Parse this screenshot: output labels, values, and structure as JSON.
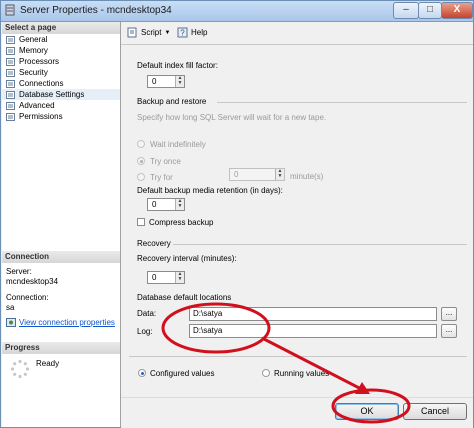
{
  "window": {
    "title": "Server Properties - mcndesktop34",
    "minimize": "–",
    "maximize": "□",
    "close": "X"
  },
  "left": {
    "select_page_header": "Select a page",
    "pages": [
      {
        "label": "General",
        "icon": "page-icon"
      },
      {
        "label": "Memory",
        "icon": "page-icon"
      },
      {
        "label": "Processors",
        "icon": "page-icon"
      },
      {
        "label": "Security",
        "icon": "page-icon"
      },
      {
        "label": "Connections",
        "icon": "page-icon"
      },
      {
        "label": "Database Settings",
        "icon": "page-icon"
      },
      {
        "label": "Advanced",
        "icon": "page-icon"
      },
      {
        "label": "Permissions",
        "icon": "page-icon"
      }
    ],
    "connection_header": "Connection",
    "server_label": "Server:",
    "server_value": "mcndesktop34",
    "connection_label": "Connection:",
    "connection_value": "sa",
    "view_connection_link": "View connection properties",
    "progress_header": "Progress",
    "progress_status": "Ready"
  },
  "toolbar": {
    "script_label": "Script",
    "help_label": "Help"
  },
  "form": {
    "fill_factor_label": "Default index fill factor:",
    "fill_factor_value": "0",
    "backup_section": "Backup and restore",
    "backup_hint": "Specify how long SQL Server will wait for a new tape.",
    "wait_indefinitely": "Wait indefinitely",
    "try_once": "Try once",
    "try_for": "Try for",
    "try_for_value": "0",
    "minutes_unit": "minute(s)",
    "retention_label": "Default backup media retention (in days):",
    "retention_value": "0",
    "compress_backup": "Compress backup",
    "recovery_section": "Recovery",
    "recovery_interval_label": "Recovery interval (minutes):",
    "recovery_interval_value": "0",
    "db_locations_label": "Database default locations",
    "data_label": "Data:",
    "data_value": "D:\\satya",
    "log_label": "Log:",
    "log_value": "D:\\satya",
    "browse_label": "...",
    "configured_values": "Configured values",
    "running_values": "Running values"
  },
  "buttons": {
    "ok": "OK",
    "cancel": "Cancel"
  },
  "colors": {
    "annotation": "#d0101c",
    "accent": "#2a63b8"
  }
}
